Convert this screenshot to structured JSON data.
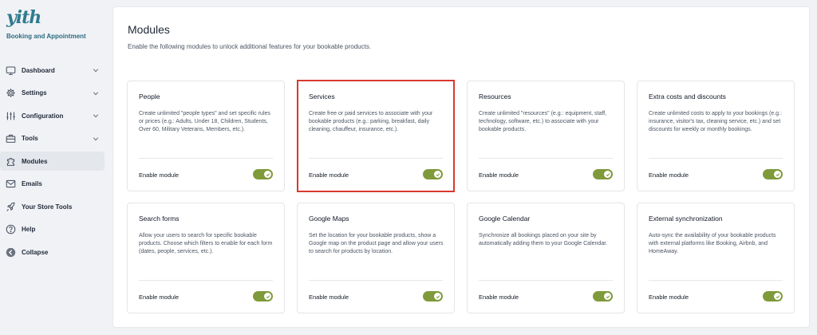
{
  "logo": {
    "text": "yith"
  },
  "sidebar": {
    "plugin_name": "Booking and Appointment",
    "items": [
      {
        "label": "Dashboard",
        "icon": "monitor-icon",
        "has_chevron": true
      },
      {
        "label": "Settings",
        "icon": "gear-icon",
        "has_chevron": true
      },
      {
        "label": "Configuration",
        "icon": "sliders-icon",
        "has_chevron": true
      },
      {
        "label": "Tools",
        "icon": "toolbox-icon",
        "has_chevron": true
      },
      {
        "label": "Modules",
        "icon": "puzzle-icon",
        "has_chevron": false,
        "active": true
      },
      {
        "label": "Emails",
        "icon": "envelope-icon",
        "has_chevron": false
      },
      {
        "label": "Your Store Tools",
        "icon": "rocket-icon",
        "has_chevron": false
      },
      {
        "label": "Help",
        "icon": "help-icon",
        "has_chevron": false
      },
      {
        "label": "Collapse",
        "icon": "collapse-icon",
        "has_chevron": false
      }
    ]
  },
  "main": {
    "title": "Modules",
    "description": "Enable the following modules to unlock additional features for your bookable products.",
    "modules": [
      {
        "title": "People",
        "description": "Create unlimited \"people types\" and set specific rules or prices (e.g.: Adults, Under 18, Children, Students, Over 60, Military Veterans, Members, etc.).",
        "footer_label": "Enable module",
        "enabled": true
      },
      {
        "title": "Services",
        "description": "Create free or paid services to associate with your bookable products (e.g.: parking, breakfast, daily cleaning, chauffeur, insurance, etc.).",
        "footer_label": "Enable module",
        "enabled": true,
        "highlighted": true
      },
      {
        "title": "Resources",
        "description": "Create unlimited \"resources\" (e.g.: equipment, staff, technology, software, etc.) to associate with your bookable products.",
        "footer_label": "Enable module",
        "enabled": true
      },
      {
        "title": "Extra costs and discounts",
        "description": "Create unlimited costs to apply to your bookings (e.g.: insurance, visitor's tax, cleaning service, etc.) and set discounts for weekly or monthly bookings.",
        "footer_label": "Enable module",
        "enabled": true
      },
      {
        "title": "Search forms",
        "description": "Allow your users to search for specific bookable products. Choose which filters to enable for each form (dates, people, services, etc.).",
        "footer_label": "Enable module",
        "enabled": true
      },
      {
        "title": "Google Maps",
        "description": "Set the location for your bookable products, show a Google map on the product page and allow your users to search for products by location.",
        "footer_label": "Enable module",
        "enabled": true
      },
      {
        "title": "Google Calendar",
        "description": "Synchronize all bookings placed on your site by automatically adding them to your Google Calendar.",
        "footer_label": "Enable module",
        "enabled": true
      },
      {
        "title": "External synchronization",
        "description": "Auto-sync the availability of your bookable products with external platforms like Booking, Airbnb, and HomeAway.",
        "footer_label": "Enable module",
        "enabled": true
      }
    ]
  },
  "colors": {
    "accent": "#2f7b8f",
    "toggle_on": "#7f9a3a",
    "highlight": "#d9392d"
  }
}
